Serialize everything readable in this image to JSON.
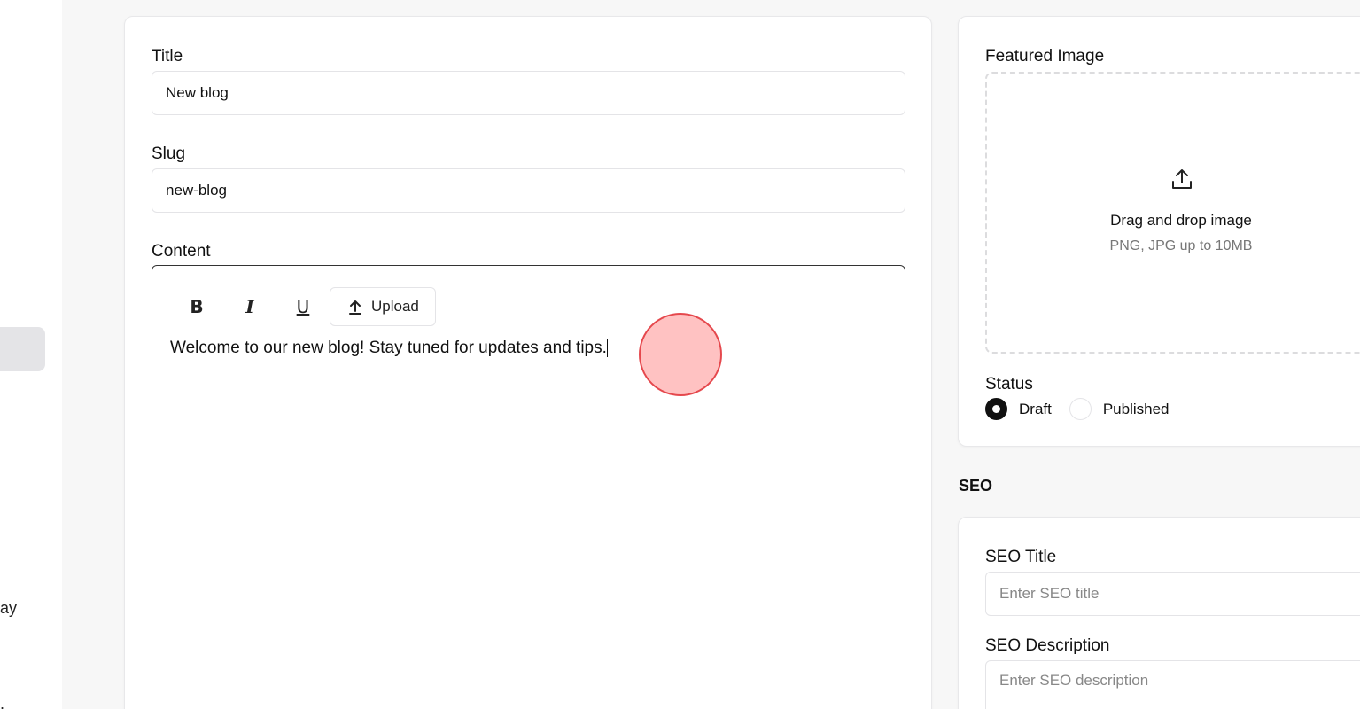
{
  "sidebar": {
    "fragment_1": "ay",
    "fragment_2": "."
  },
  "form": {
    "title_label": "Title",
    "title_value": "New blog",
    "slug_label": "Slug",
    "slug_value": "new-blog",
    "content_label": "Content",
    "toolbar": {
      "bold": "B",
      "italic": "I",
      "underline": "U",
      "upload_label": "Upload"
    },
    "content_text": "Welcome to our new blog! Stay tuned for updates and tips."
  },
  "featured": {
    "label": "Featured Image",
    "drop_main": "Drag and drop image",
    "drop_sub": "PNG, JPG up to 10MB",
    "upload_icon": "upload-icon"
  },
  "status": {
    "label": "Status",
    "options": [
      {
        "label": "Draft",
        "checked": true
      },
      {
        "label": "Published",
        "checked": false
      }
    ]
  },
  "seo": {
    "heading": "SEO",
    "title_label": "SEO Title",
    "title_placeholder": "Enter SEO title",
    "desc_label": "SEO Description",
    "desc_placeholder": "Enter SEO description"
  },
  "colors": {
    "cursor_fill": "#ff7878",
    "cursor_stroke": "#e5484d",
    "active_sidebar": "#e4e4e7"
  }
}
